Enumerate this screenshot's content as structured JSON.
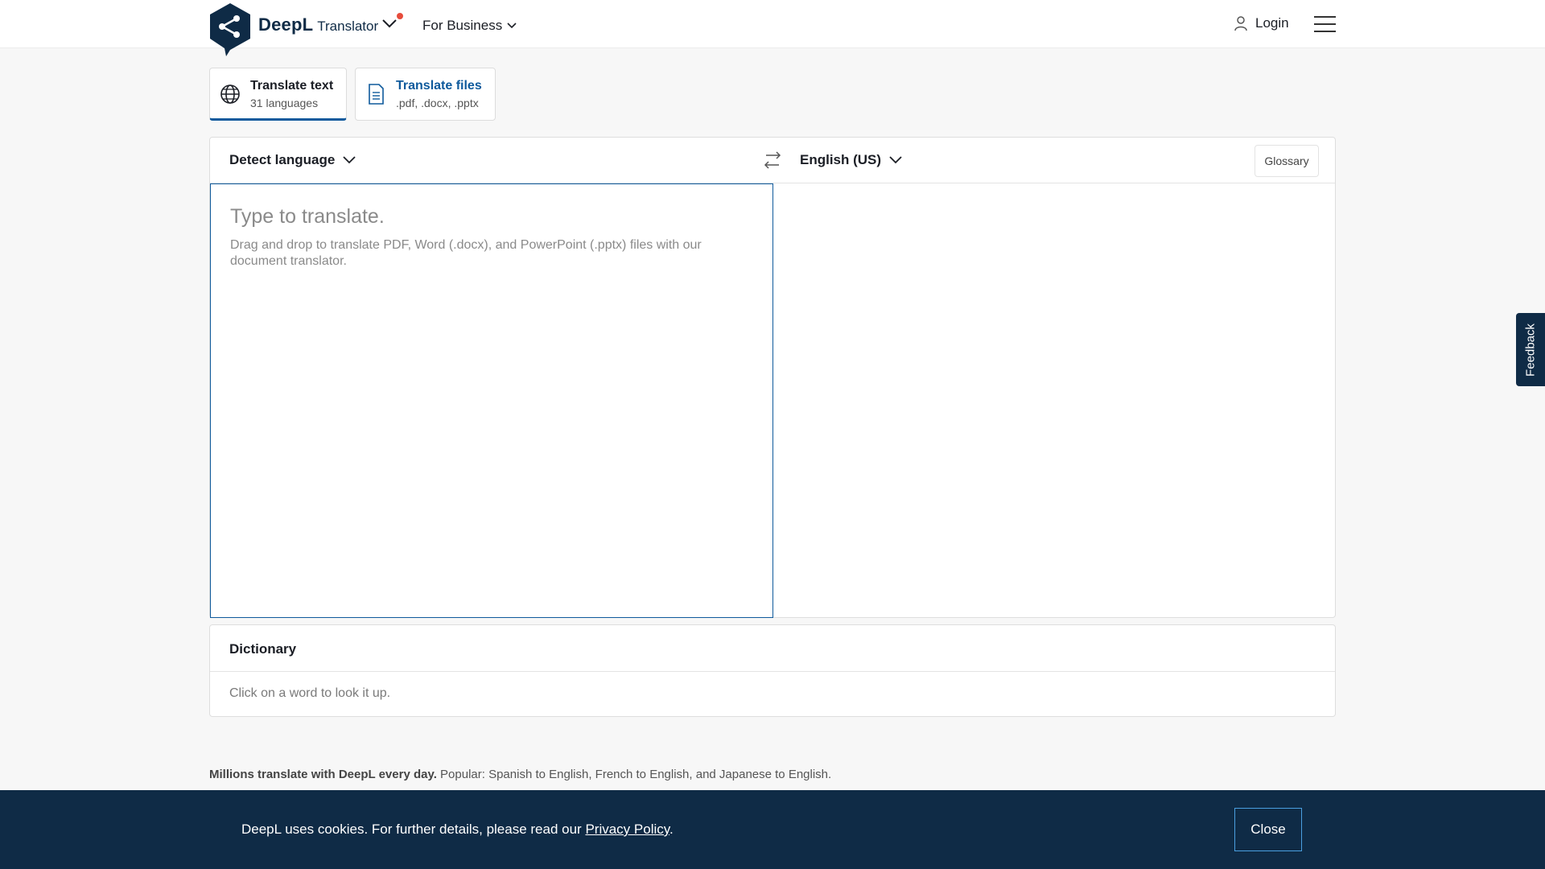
{
  "header": {
    "brand_name": "DeepL",
    "brand_sub": "Translator",
    "for_business": "For Business",
    "login": "Login"
  },
  "tabs": [
    {
      "title": "Translate text",
      "sub": "31 languages"
    },
    {
      "title": "Translate files",
      "sub": ".pdf, .docx, .pptx"
    }
  ],
  "translator": {
    "source_lang": "Detect language",
    "target_lang": "English (US)",
    "glossary": "Glossary",
    "placeholder": "Type to translate.",
    "hint": "Drag and drop to translate PDF, Word (.docx), and PowerPoint (.pptx) files with our document translator."
  },
  "dictionary": {
    "title": "Dictionary",
    "hint": "Click on a word to look it up."
  },
  "popular": {
    "bold": "Millions translate with DeepL every day.",
    "text": "Popular: Spanish to English, French to English, and Japanese to English."
  },
  "feedback": "Feedback",
  "cookie": {
    "text_before": "DeepL uses cookies. For further details, please read our",
    "link": "Privacy Policy",
    "text_after": ".",
    "close": "Close"
  },
  "colors": {
    "brand_navy": "#0f2b46",
    "accent_blue": "#0f5a9c",
    "notification_red": "#e74c3c"
  }
}
